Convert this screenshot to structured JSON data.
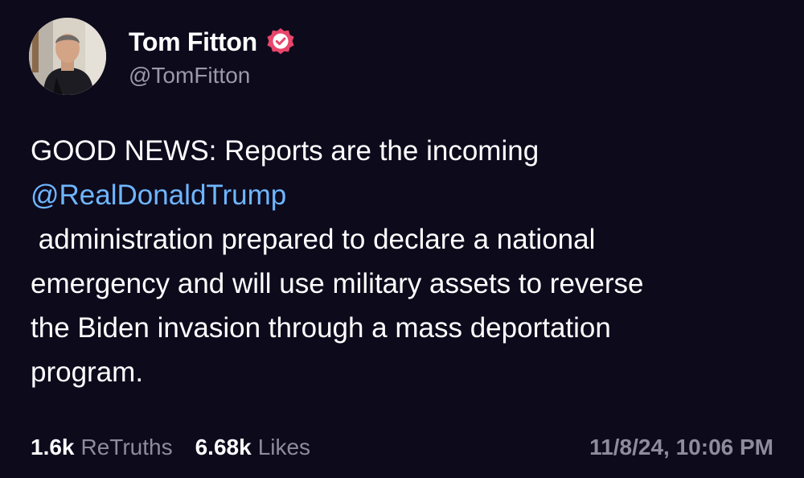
{
  "author": {
    "display_name": "Tom Fitton",
    "handle": "@TomFitton",
    "verified_badge_color": "#e8466a"
  },
  "post": {
    "text_intro": "GOOD NEWS: Reports are the incoming",
    "mention": "@RealDonaldTrump",
    "text_lines": [
      " administration prepared to declare a national",
      "emergency and will use military assets to reverse",
      "the Biden invasion through a mass deportation",
      "program."
    ]
  },
  "stats": {
    "retruths_count": "1.6k",
    "retruths_label": "ReTruths",
    "likes_count": "6.68k",
    "likes_label": "Likes",
    "timestamp": "11/8/24, 10:06 PM"
  },
  "colors": {
    "background": "#0d0a1c",
    "mention": "#6fb6ff",
    "muted_text": "#8e8c9c"
  }
}
